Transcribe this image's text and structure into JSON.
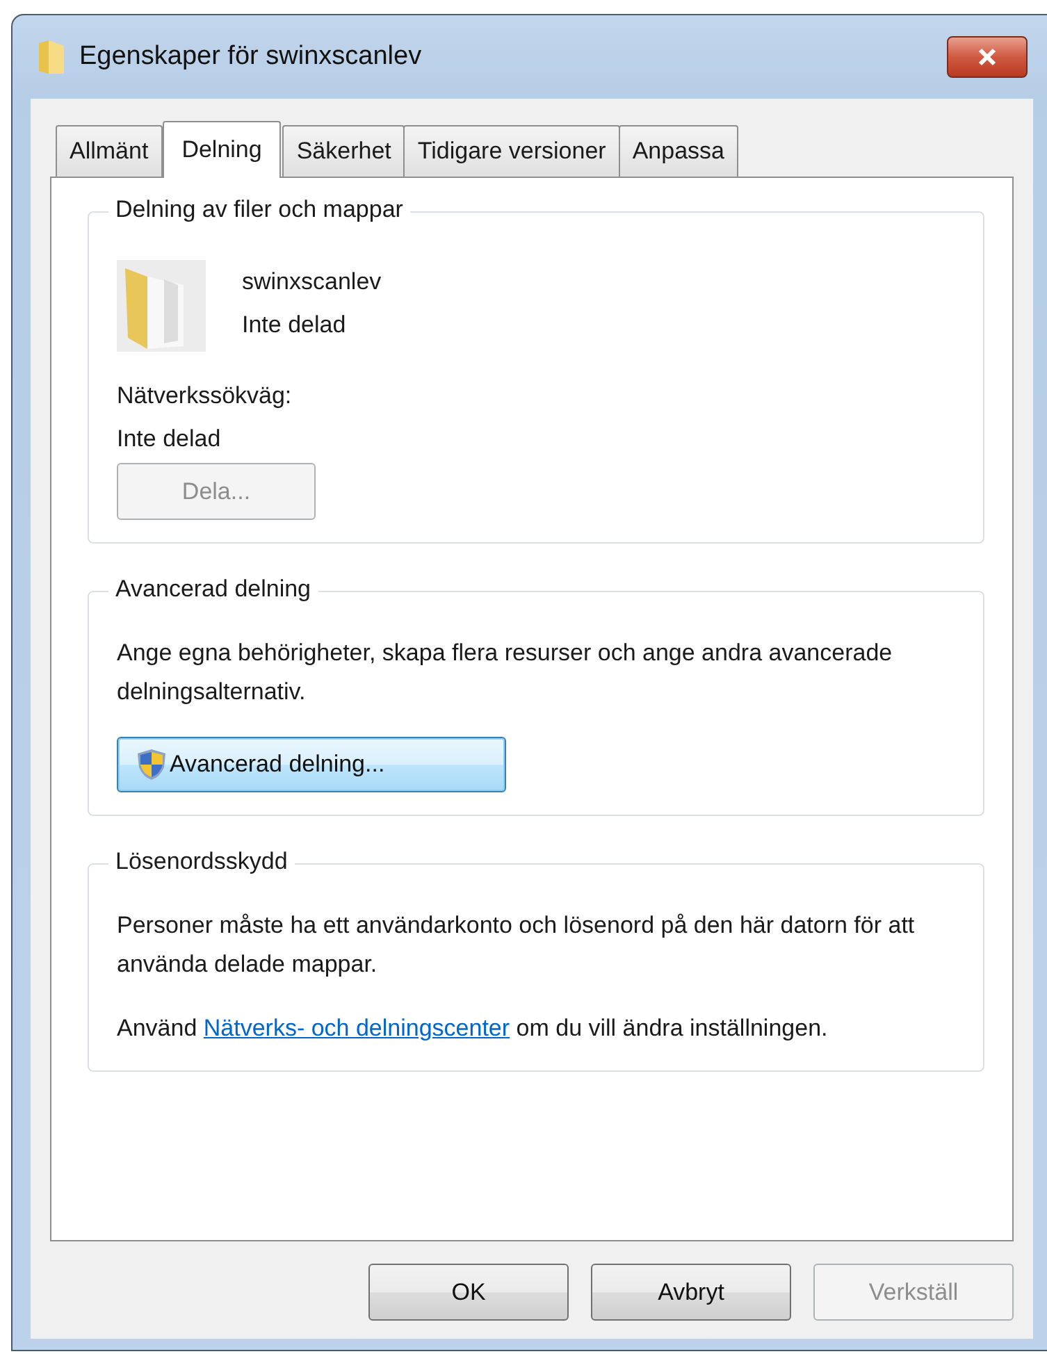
{
  "window": {
    "title": "Egenskaper för swinxscanlev"
  },
  "tabs": [
    {
      "label": "Allmänt",
      "selected": false
    },
    {
      "label": "Delning",
      "selected": true
    },
    {
      "label": "Säkerhet",
      "selected": false
    },
    {
      "label": "Tidigare versioner",
      "selected": false
    },
    {
      "label": "Anpassa",
      "selected": false
    }
  ],
  "file_sharing": {
    "title": "Delning av filer och mappar",
    "name": "swinxscanlev",
    "status": "Inte delad",
    "path_label": "Nätverkssökväg:",
    "path_value": "Inte delad",
    "button": {
      "label": "Dela...",
      "disabled": true
    }
  },
  "advanced_sharing": {
    "title": "Avancerad delning",
    "description": "Ange egna behörigheter, skapa flera resurser och ange andra avancerade delningsalternativ.",
    "button": {
      "label": "Avancerad delning...",
      "disabled": false,
      "focused": true
    }
  },
  "password_protection": {
    "title": "Lösenordsskydd",
    "description": "Personer måste ha ett användarkonto och lösenord på den här datorn för att använda delade mappar.",
    "footer": {
      "prefix": "Använd ",
      "link": "Nätverks- och delningscenter",
      "suffix": " om du vill ändra inställningen."
    }
  },
  "buttons": [
    {
      "label": "OK",
      "disabled": false
    },
    {
      "label": "Avbryt",
      "disabled": false
    },
    {
      "label": "Verkställ",
      "disabled": true
    }
  ]
}
